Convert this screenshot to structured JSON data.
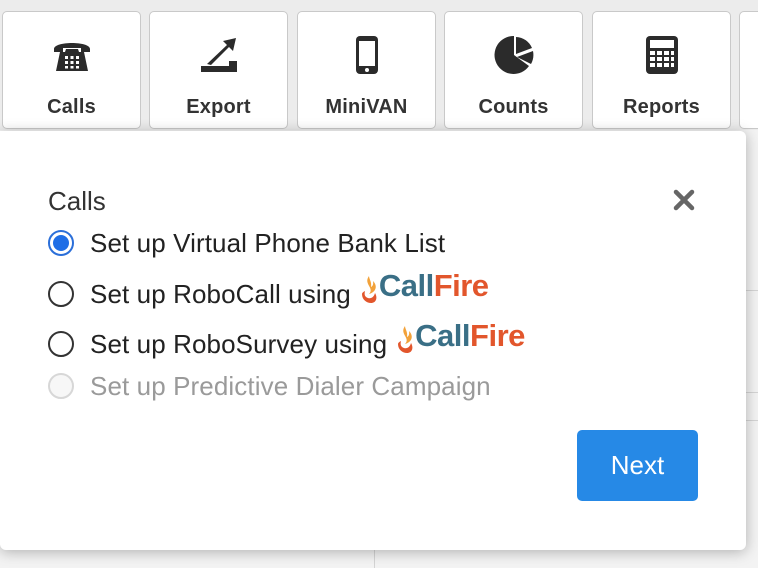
{
  "toolbar": {
    "items": [
      {
        "label": "Calls",
        "icon": "telephone-icon"
      },
      {
        "label": "Export",
        "icon": "export-icon"
      },
      {
        "label": "MiniVAN",
        "icon": "mobile-phone-icon"
      },
      {
        "label": "Counts",
        "icon": "pie-chart-icon"
      },
      {
        "label": "Reports",
        "icon": "calculator-icon"
      }
    ]
  },
  "modal": {
    "title": "Calls",
    "close_icon": "close-icon",
    "options": [
      {
        "label": "Set up Virtual Phone Bank List",
        "checked": true,
        "disabled": false
      },
      {
        "label": "Set up RoboCall using",
        "checked": false,
        "disabled": false,
        "logo": "CallFire"
      },
      {
        "label": "Set up RoboSurvey using",
        "checked": false,
        "disabled": false,
        "logo": "CallFire"
      },
      {
        "label": "Set up Predictive Dialer Campaign",
        "checked": false,
        "disabled": true
      }
    ],
    "logo": {
      "part1": "Call",
      "part2": "Fire"
    },
    "next_label": "Next"
  },
  "colors": {
    "accent": "#2689e6",
    "radio_checked": "#1f6ee6",
    "callfire_call": "#3a6f86",
    "callfire_fire": "#e2562c",
    "disabled_text": "#9a9a9a"
  }
}
